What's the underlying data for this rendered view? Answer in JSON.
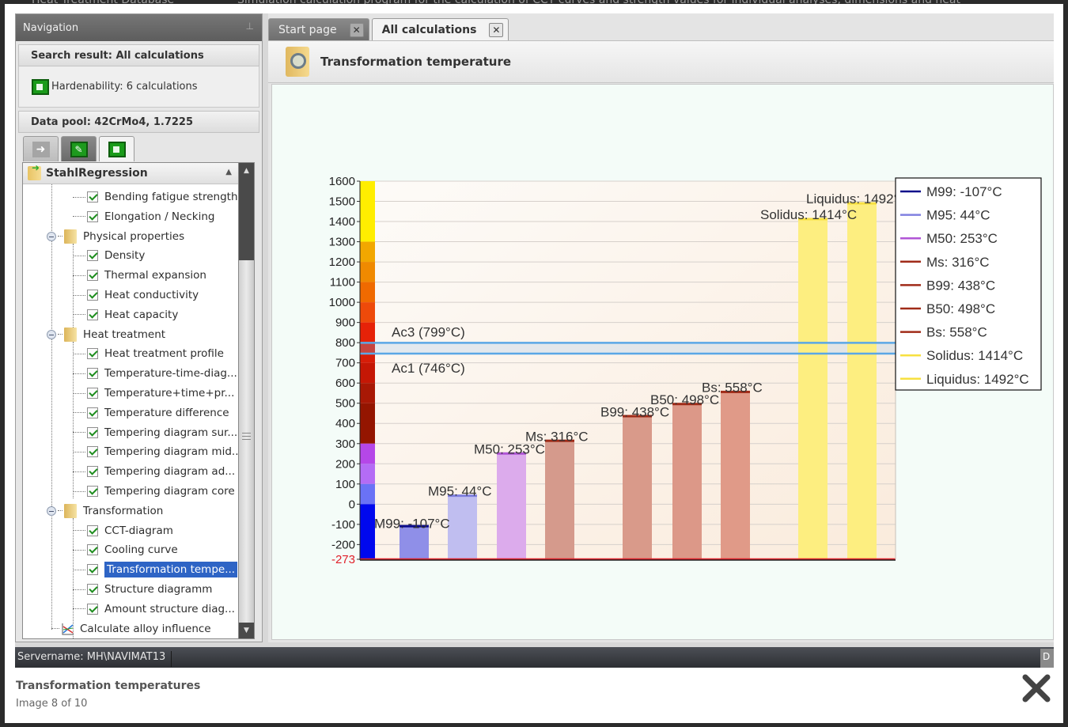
{
  "backdrop": {
    "top_text_left": "Heat Treatment Database",
    "top_text": "Simulation calculation program for the calculation of CCT curves and strength values for individual analyses, dimensions and heat"
  },
  "navigation": {
    "header": "Navigation",
    "pin_icon": "pin-icon",
    "search_result_label": "Search result: All calculations",
    "search_result_item": "Hardenability: 6 calculations",
    "data_pool_label": "Data pool: 42CrMo4, 1.7225",
    "tab_icons": [
      "arrow-right-icon",
      "edit-icon",
      "hardenability-icon"
    ],
    "tree": {
      "root": "StahlRegression",
      "items": [
        {
          "label": "Bending fatigue strength",
          "type": "leaf",
          "checked": true
        },
        {
          "label": "Elongation / Necking",
          "type": "leaf",
          "checked": true
        },
        {
          "label": "Physical properties",
          "type": "folder"
        },
        {
          "label": "Density",
          "type": "leaf",
          "checked": true
        },
        {
          "label": "Thermal expansion",
          "type": "leaf",
          "checked": true
        },
        {
          "label": "Heat conductivity",
          "type": "leaf",
          "checked": true
        },
        {
          "label": "Heat capacity",
          "type": "leaf",
          "checked": true
        },
        {
          "label": "Heat treatment",
          "type": "folder"
        },
        {
          "label": "Heat treatment profile",
          "type": "leaf",
          "checked": true
        },
        {
          "label": "Temperature-time-diag...",
          "type": "leaf",
          "checked": true
        },
        {
          "label": "Temperature+time+pr...",
          "type": "leaf",
          "checked": true
        },
        {
          "label": "Temperature difference",
          "type": "leaf",
          "checked": true
        },
        {
          "label": "Tempering diagram sur...",
          "type": "leaf",
          "checked": true
        },
        {
          "label": "Tempering diagram mid...",
          "type": "leaf",
          "checked": true
        },
        {
          "label": "Tempering diagram ad...",
          "type": "leaf",
          "checked": true
        },
        {
          "label": "Tempering diagram core",
          "type": "leaf",
          "checked": true
        },
        {
          "label": "Transformation",
          "type": "folder"
        },
        {
          "label": "CCT-diagram",
          "type": "leaf",
          "checked": true
        },
        {
          "label": "Cooling curve",
          "type": "leaf",
          "checked": true
        },
        {
          "label": "Transformation tempe...",
          "type": "leaf",
          "checked": true,
          "selected": true
        },
        {
          "label": "Structure diagramm",
          "type": "leaf",
          "checked": true
        },
        {
          "label": "Amount structure diag...",
          "type": "leaf",
          "checked": true
        },
        {
          "label": "Calculate alloy influence",
          "type": "tool"
        }
      ]
    }
  },
  "tabs": [
    {
      "label": "Start page",
      "active": false
    },
    {
      "label": "All calculations",
      "active": true
    }
  ],
  "page_title": "Transformation temperature",
  "status": {
    "server": "Servername: MH\\NAVIMAT13",
    "right_text": "D"
  },
  "caption": {
    "title": "Transformation temperatures",
    "counter": "Image 8 of 10"
  },
  "chart_data": {
    "type": "bar",
    "title": "",
    "xlabel": "",
    "ylabel": "",
    "ylim": [
      -273,
      1600
    ],
    "yticks": [
      1600,
      1500,
      1400,
      1300,
      1200,
      1100,
      1000,
      900,
      800,
      700,
      600,
      500,
      400,
      300,
      200,
      100,
      0,
      -100,
      -200,
      -273
    ],
    "ytick_labels": [
      "1600",
      "1500",
      "1400",
      "1300",
      "1200",
      "1100",
      "1000",
      "900",
      "800",
      "700",
      "600",
      "500",
      "400",
      "300",
      "200",
      "100",
      "0",
      "-100",
      "-200",
      "-273"
    ],
    "bottom_tick_color": "#e0202a",
    "grid": true,
    "legend_position": "top-right",
    "color_scale": [
      {
        "from": 1300,
        "to": 1600,
        "color": "#ffee00"
      },
      {
        "from": 1200,
        "to": 1300,
        "color": "#f2a700"
      },
      {
        "from": 1100,
        "to": 1200,
        "color": "#f08a00"
      },
      {
        "from": 1000,
        "to": 1100,
        "color": "#f06a00"
      },
      {
        "from": 900,
        "to": 1000,
        "color": "#ee4a0a"
      },
      {
        "from": 800,
        "to": 900,
        "color": "#e62208"
      },
      {
        "from": 700,
        "to": 800,
        "color": "#d71d08"
      },
      {
        "from": 600,
        "to": 700,
        "color": "#c51705"
      },
      {
        "from": 500,
        "to": 600,
        "color": "#a81805"
      },
      {
        "from": 300,
        "to": 500,
        "color": "#941500"
      },
      {
        "from": 200,
        "to": 300,
        "color": "#b547e8"
      },
      {
        "from": 100,
        "to": 200,
        "color": "#b46cf5"
      },
      {
        "from": 0,
        "to": 100,
        "color": "#6a72f6"
      },
      {
        "from": -273,
        "to": 0,
        "color": "#0008ee"
      }
    ],
    "reference_lines": [
      {
        "label": "Ac3 (799°C)",
        "value": 799,
        "color": "#5aa7e6"
      },
      {
        "label": "Ac1 (746°C)",
        "value": 746,
        "color": "#5aa7e6"
      },
      {
        "label": "",
        "value": -273,
        "color": "#e0202a"
      }
    ],
    "bars": [
      {
        "name": "M99",
        "value": -107,
        "label": "M99: -107°C",
        "fill": "#8f8fe8",
        "cap": "#0a0a8a",
        "legend": "M99: -107°C"
      },
      {
        "name": "M95",
        "value": 44,
        "label": "M95: 44°C",
        "fill": "#c0bef0",
        "cap": "#8080e0",
        "legend": "M95: 44°C"
      },
      {
        "name": "M50",
        "value": 253,
        "label": "M50: 253°C",
        "fill": "#dcabec",
        "cap": "#b055d6",
        "legend": "M50: 253°C"
      },
      {
        "name": "Ms",
        "value": 316,
        "label": "Ms: 316°C",
        "fill": "#d59a8c",
        "cap": "#a02b18",
        "legend": "Ms: 316°C"
      },
      {
        "name": "B99",
        "value": 438,
        "label": "B99: 438°C",
        "fill": "#d99a8a",
        "cap": "#a02b18",
        "legend": "B99: 438°C"
      },
      {
        "name": "B50",
        "value": 498,
        "label": "B50: 498°C",
        "fill": "#dc9888",
        "cap": "#a02b18",
        "legend": "B50: 498°C"
      },
      {
        "name": "Bs",
        "value": 558,
        "label": "Bs: 558°C",
        "fill": "#e09a88",
        "cap": "#a02b18",
        "legend": "Bs: 558°C"
      },
      {
        "name": "Solidus",
        "value": 1414,
        "label": "Solidus: 1414°C",
        "fill": "#fdee80",
        "cap": "#f7e040",
        "legend": "Solidus: 1414°C"
      },
      {
        "name": "Liquidus",
        "value": 1492,
        "label": "Liquidus: 1492°C",
        "fill": "#fdee80",
        "cap": "#f7e040",
        "legend": "Liquidus: 1492°C"
      }
    ],
    "legend_colors": [
      "#0a0a8a",
      "#8080e0",
      "#b055d6",
      "#a02b18",
      "#a02b18",
      "#a02b18",
      "#a02b18",
      "#f7e040",
      "#f7e040"
    ]
  }
}
